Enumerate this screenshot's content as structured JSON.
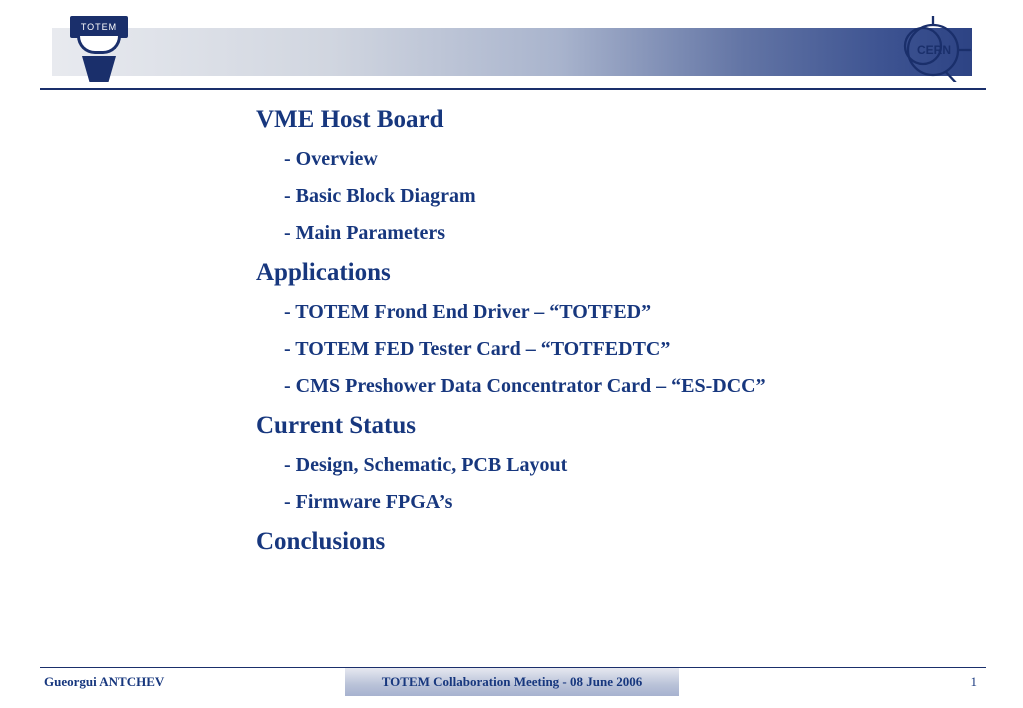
{
  "logo_left_text": "TOTEM",
  "logo_right_text": "CERN",
  "sections": [
    {
      "title": "VME Host Board",
      "items": [
        "- Overview",
        "- Basic Block Diagram",
        "- Main Parameters"
      ]
    },
    {
      "title": "Applications",
      "items": [
        "- TOTEM Frond End Driver – “TOTFED”",
        "- TOTEM FED Tester Card – “TOTFEDTC”",
        "- CMS Preshower Data Concentrator Card – “ES-DCC”"
      ]
    },
    {
      "title": "Current Status",
      "items": [
        "- Design, Schematic,  PCB Layout",
        "- Firmware FPGA’s"
      ]
    },
    {
      "title": "Conclusions",
      "items": []
    }
  ],
  "footer": {
    "author": "Gueorgui ANTCHEV",
    "meeting": "TOTEM Collaboration Meeting  - 08 June 2006",
    "page": "1"
  }
}
